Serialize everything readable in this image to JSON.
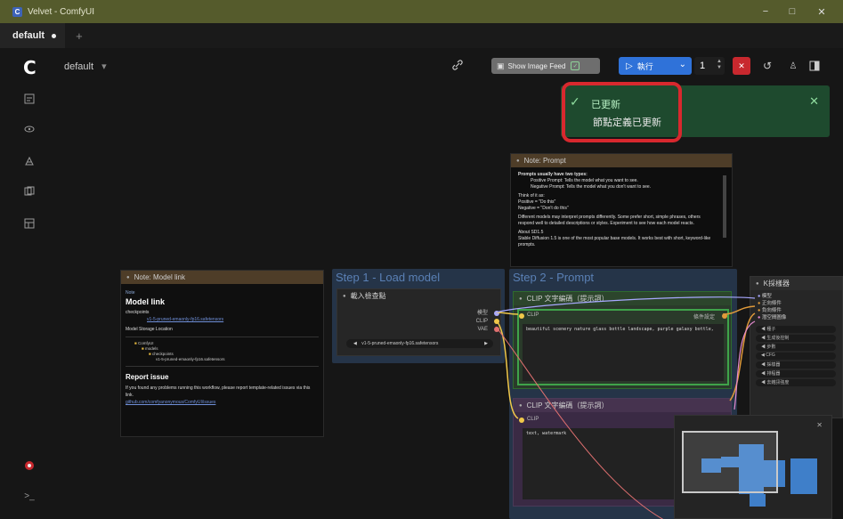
{
  "window": {
    "title": "Velvet - ComfyUI",
    "app_icon": "C",
    "minimize": "−",
    "maximize": "□",
    "close": "✕"
  },
  "tabs": [
    {
      "label": "default"
    }
  ],
  "tab_add": "+",
  "toolbar": {
    "logo": "C",
    "workflow_name": "default",
    "workflow_chevron": "▾",
    "image_feed_label": "Show Image Feed",
    "run_label": "執行",
    "queue_count": "1",
    "colors": {
      "run": "#2f72d9",
      "stop": "#c8282e",
      "image_feed": "#6e6e6e"
    }
  },
  "toast": {
    "title": "已更新",
    "body": "節點定義已更新",
    "highlight_color": "#d8282e",
    "background": "#1e4a2e"
  },
  "nodes": {
    "model_note": {
      "header": "Note: Model link",
      "tag": "Note",
      "title": "Model link",
      "label": "checkpoints",
      "link": "v1-5-pruned-emaonly-fp16.safetensors",
      "location": "Model Storage Location",
      "tree": [
        "ComfyUI",
        "models",
        "checkpoints",
        "v1-5-pruned-emaonly-fp16.safetensors"
      ],
      "issue_title": "Report issue",
      "issue_body": "If you found any problems running this workflow, please report template-related issues via this link.",
      "issue_link": "github.com/comfyanonymous/ComfyUI/issues"
    },
    "load_group": {
      "title": "Step 1 - Load model",
      "node_header": "載入檢查點",
      "outputs": [
        "模型",
        "CLIP",
        "VAE"
      ],
      "ckpt_value": "v1-5-pruned-emaonly-fp16.safetensors"
    },
    "prompt_group": {
      "title": "Step 2 - Prompt",
      "positive_header": "CLIP 文字編碼（提示詞）",
      "positive_input": "CLIP",
      "positive_output": "條件設定",
      "positive_text": "beautiful scenery nature glass bottle landscape, purple galaxy bottle,",
      "negative_header": "CLIP 文字編碼（提示詞）",
      "negative_input": "CLIP",
      "negative_text": "text, watermark"
    },
    "prompt_note": {
      "header": "Note: Prompt",
      "lead": "Prompts usually have two types:",
      "items": [
        "Positive Prompt: Tells the model what you want to see.",
        "Negative Prompt: Tells the model what you don't want to see."
      ],
      "think_of": "Think of it as:",
      "think_items": [
        "Positive = \"Do this\"",
        "Negative = \"Don't do this\""
      ],
      "para1": "Different models may interpret prompts differently. Some prefer short, simple phrases, others respond well to detailed descriptions or styles. Experiment to see how each model reacts.",
      "para2_head": "About SD1.5",
      "para2": "Stable Diffusion 1.5 is one of the most popular base models. It works best with short, keyword-like prompts."
    },
    "ksampler": {
      "header": "K採樣器",
      "inputs": [
        "模型",
        "正向條件",
        "負向條件",
        "潛空間圖像"
      ],
      "widgets": [
        "種子",
        "生成後控制",
        "步數",
        "CFG",
        "採樣器",
        "排程器",
        "去雜訊強度"
      ]
    }
  },
  "minimap": {
    "close": "✕"
  }
}
